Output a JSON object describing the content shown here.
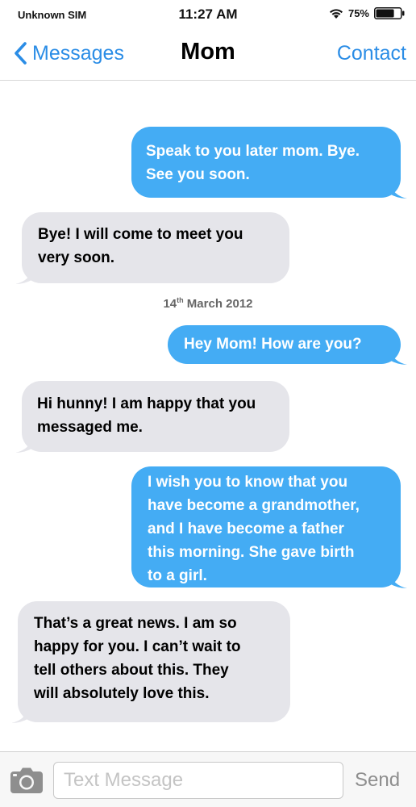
{
  "status_bar": {
    "carrier": "Unknown SIM",
    "time": "11:27 AM",
    "battery_percent": "75%",
    "battery_level": 0.75,
    "wifi_icon": "wifi-icon",
    "battery_icon": "battery-icon"
  },
  "nav": {
    "back_label": "Messages",
    "title": "Mom",
    "action_label": "Contact",
    "back_icon": "chevron-left-icon",
    "accent_color": "#2b8de6"
  },
  "thread": {
    "date_day": "14",
    "date_suffix": "th",
    "date_rest": " March 2012",
    "outgoing_color": "#44acf4",
    "incoming_color": "#e5e5ea",
    "messages": [
      {
        "direction": "outgoing",
        "lines": [
          "Speak to you later mom. Bye.",
          "See you soon."
        ]
      },
      {
        "direction": "incoming",
        "lines": [
          "Bye! I will come to meet you",
          "very soon."
        ]
      },
      {
        "direction": "outgoing",
        "lines": [
          "Hey Mom! How are you?"
        ]
      },
      {
        "direction": "incoming",
        "lines": [
          "Hi hunny! I am happy that you",
          "messaged me."
        ]
      },
      {
        "direction": "outgoing",
        "lines": [
          "I wish you to know that you",
          "have become a grandmother,",
          "and I have become a father",
          "this morning. She gave birth",
          "to a girl."
        ]
      },
      {
        "direction": "incoming",
        "lines": [
          "That’s a great news. I am so",
          "happy for you. I can’t wait to",
          "tell others about this. They",
          "will absolutely love this."
        ]
      }
    ]
  },
  "input_bar": {
    "placeholder": "Text Message",
    "value": "",
    "send_label": "Send",
    "camera_icon": "camera-icon"
  }
}
